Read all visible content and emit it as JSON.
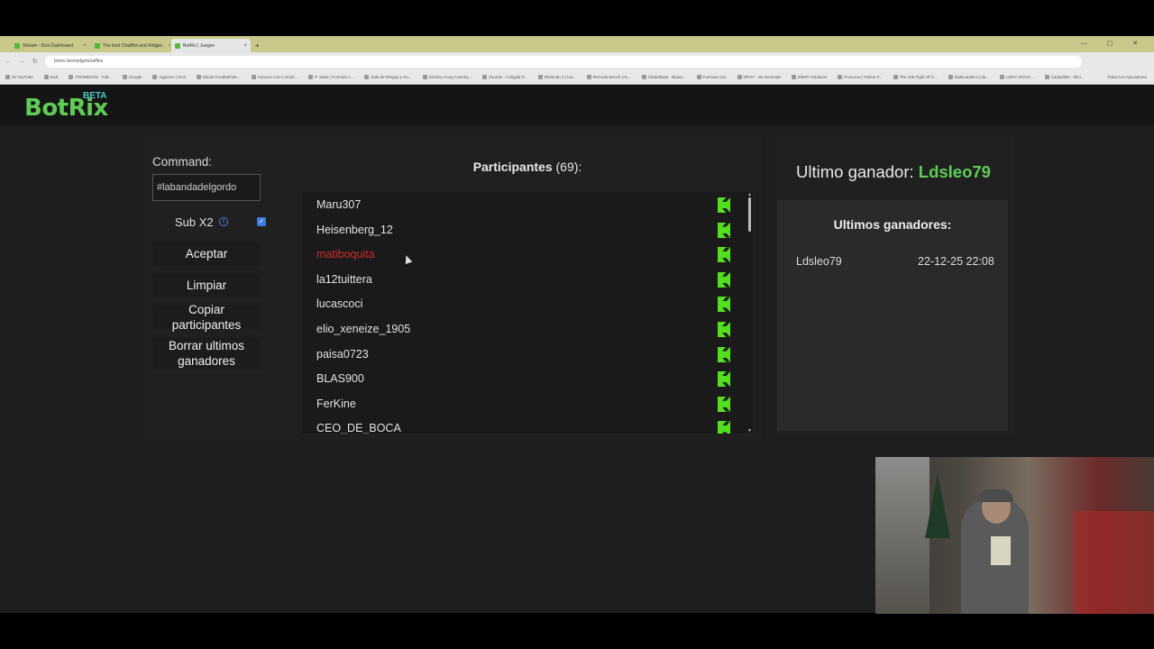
{
  "browser": {
    "tabs": [
      {
        "label": "Stream - Kick Dashboard",
        "active": false
      },
      {
        "label": "The best ChatBot and Widget...",
        "active": false
      },
      {
        "label": "BotRix | Juegos",
        "active": true
      }
    ],
    "new_tab": "+",
    "url": "botrix.live/widgets/raffles",
    "bookmarks": [
      "Mi YouTube",
      "Kick",
      "TROWEXXX - Full...",
      "Google",
      "Ingresos | Kick",
      "Ebook Football We...",
      "Amazon.com | amaz...",
      "P. stack | Formula 1...",
      "Sala de Mingoy y Hu...",
      "Donkey Kong Country...",
      "Zoomie - A Digital P...",
      "Nintendo 3 | Ha...",
      "ReCode Bench 1%...",
      "ChatelData - Biana...",
      "Formula Uno",
      "NPHY - Se Nonestat",
      "ZMKR Solutions",
      "Proxcess | Online F...",
      "The 100 Fight Of C...",
      "Multicanals.it | da...",
      "LWAC DOCE...",
      "Cardwilder - Biro..."
    ],
    "bookmarks_right": "Todos los marcadores"
  },
  "app": {
    "logo": "BotRix",
    "badge": "BETA"
  },
  "controls": {
    "command_label": "Command:",
    "command_value": "#labandadelgordo",
    "sub_label": "Sub X2",
    "sub_checked": true,
    "info_icon": "i",
    "check_mark": "✓",
    "accept_label": "Aceptar",
    "clear_label": "Limpiar",
    "copy_label": "Copiar participantes",
    "delete_label": "Borrar ultimos ganadores"
  },
  "participants": {
    "title": "Participantes",
    "count": "(69):",
    "items": [
      {
        "name": "Maru307",
        "highlight": false
      },
      {
        "name": "Heisenberg_12",
        "highlight": false
      },
      {
        "name": "matiboquita",
        "highlight": true
      },
      {
        "name": "la12tuittera",
        "highlight": false
      },
      {
        "name": "lucascoci",
        "highlight": false
      },
      {
        "name": "elio_xeneize_1905",
        "highlight": false
      },
      {
        "name": "paisa0723",
        "highlight": false
      },
      {
        "name": "BLAS900",
        "highlight": false
      },
      {
        "name": "FerKine",
        "highlight": false
      },
      {
        "name": "CEO_DE_BOCA",
        "highlight": false
      }
    ]
  },
  "winner": {
    "label": "Ultimo ganador: ",
    "name": "Ldsleo79",
    "history_title": "Ultimos ganadores:",
    "history": [
      {
        "name": "Ldsleo79",
        "date": "22-12-25 22:08"
      }
    ]
  },
  "colors": {
    "accent": "#5fcc56",
    "kick_green": "#53e01f",
    "highlight_red": "#d02b2b",
    "checkbox_blue": "#3b7ddd"
  }
}
